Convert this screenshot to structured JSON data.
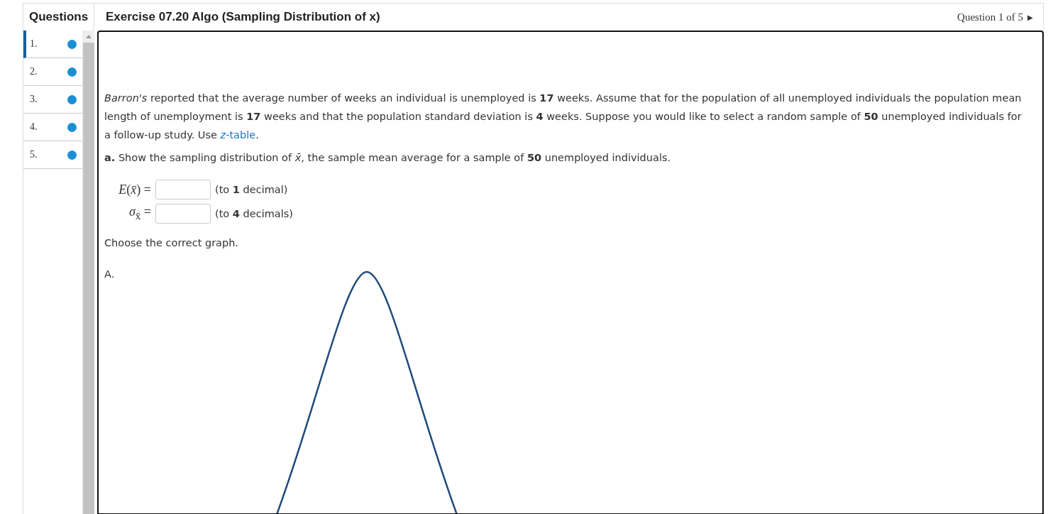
{
  "sidebar": {
    "title": "Questions",
    "items": [
      {
        "label": "1.",
        "selected": true
      },
      {
        "label": "2.",
        "selected": false
      },
      {
        "label": "3.",
        "selected": false
      },
      {
        "label": "4.",
        "selected": false
      },
      {
        "label": "5.",
        "selected": false
      }
    ]
  },
  "header": {
    "title": "Exercise 07.20 Algo (Sampling Distribution of x)",
    "position": "Question 1 of 5",
    "next": "▶"
  },
  "question": {
    "paragraph": {
      "text": "*Barron's* reported that the average number of weeks an individual is unemployed is **17** weeks. Assume that for the population of all unemployed individuals the population mean length of unemployment is **17** weeks and that the population standard deviation is **4** weeks. Suppose you would like to select a random sample of **50** unemployed individuals for a follow-up study. Use ",
      "link": "*z*-table",
      "after": "."
    },
    "part": "**a.** Show the sampling distribution of *x̄*, the sample mean average for a sample of **50** unemployed individuals.",
    "fields": [
      {
        "label": "*E*(*x̄*) =",
        "hint": "(to **1** decimal)"
      },
      {
        "label": "*σ*$_{x̄}$ =",
        "hint": "(to **4** decimals)"
      }
    ],
    "instruction": "Choose the correct graph.",
    "options": [
      {
        "label": "A."
      }
    ]
  }
}
